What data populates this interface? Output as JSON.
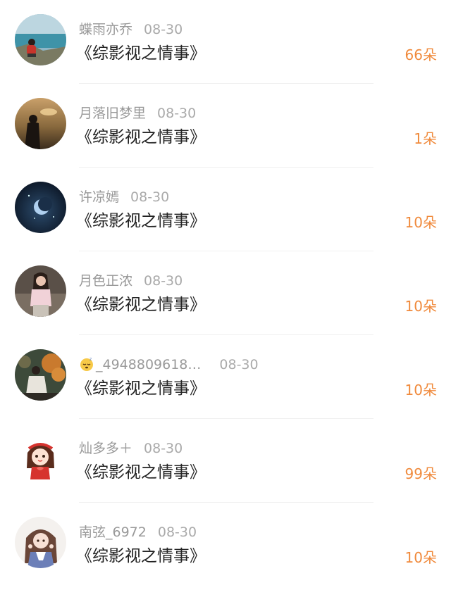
{
  "items": [
    {
      "name": "蝶雨亦乔",
      "date": "08-30",
      "title": "《综影视之情事》",
      "amount": "66朵",
      "avatar_icon": "lakeside-person-avatar"
    },
    {
      "name": "月落旧梦里",
      "date": "08-30",
      "title": "《综影视之情事》",
      "amount": "1朵",
      "avatar_icon": "sunset-silhouette-avatar"
    },
    {
      "name": "许凉嫣",
      "date": "08-30",
      "title": "《综影视之情事》",
      "amount": "10朵",
      "avatar_icon": "night-moon-avatar"
    },
    {
      "name": "月色正浓",
      "date": "08-30",
      "title": "《综影视之情事》",
      "amount": "10朵",
      "avatar_icon": "girl-portrait-avatar"
    },
    {
      "name": "_4948809618…",
      "date": "08-30",
      "title": "《综影视之情事》",
      "amount": "10朵",
      "avatar_icon": "autumn-leaves-avatar",
      "name_emoji": "sleepy-face-emoji"
    },
    {
      "name": "灿多多＋",
      "date": "08-30",
      "title": "《综影视之情事》",
      "amount": "99朵",
      "avatar_icon": "cartoon-girl-avatar"
    },
    {
      "name": "南弦_6972",
      "date": "08-30",
      "title": "《综影视之情事》",
      "amount": "10朵",
      "avatar_icon": "anime-girl-avatar"
    }
  ],
  "colors": {
    "amount": "#f08a3c",
    "meta": "#999999",
    "title": "#222222"
  }
}
